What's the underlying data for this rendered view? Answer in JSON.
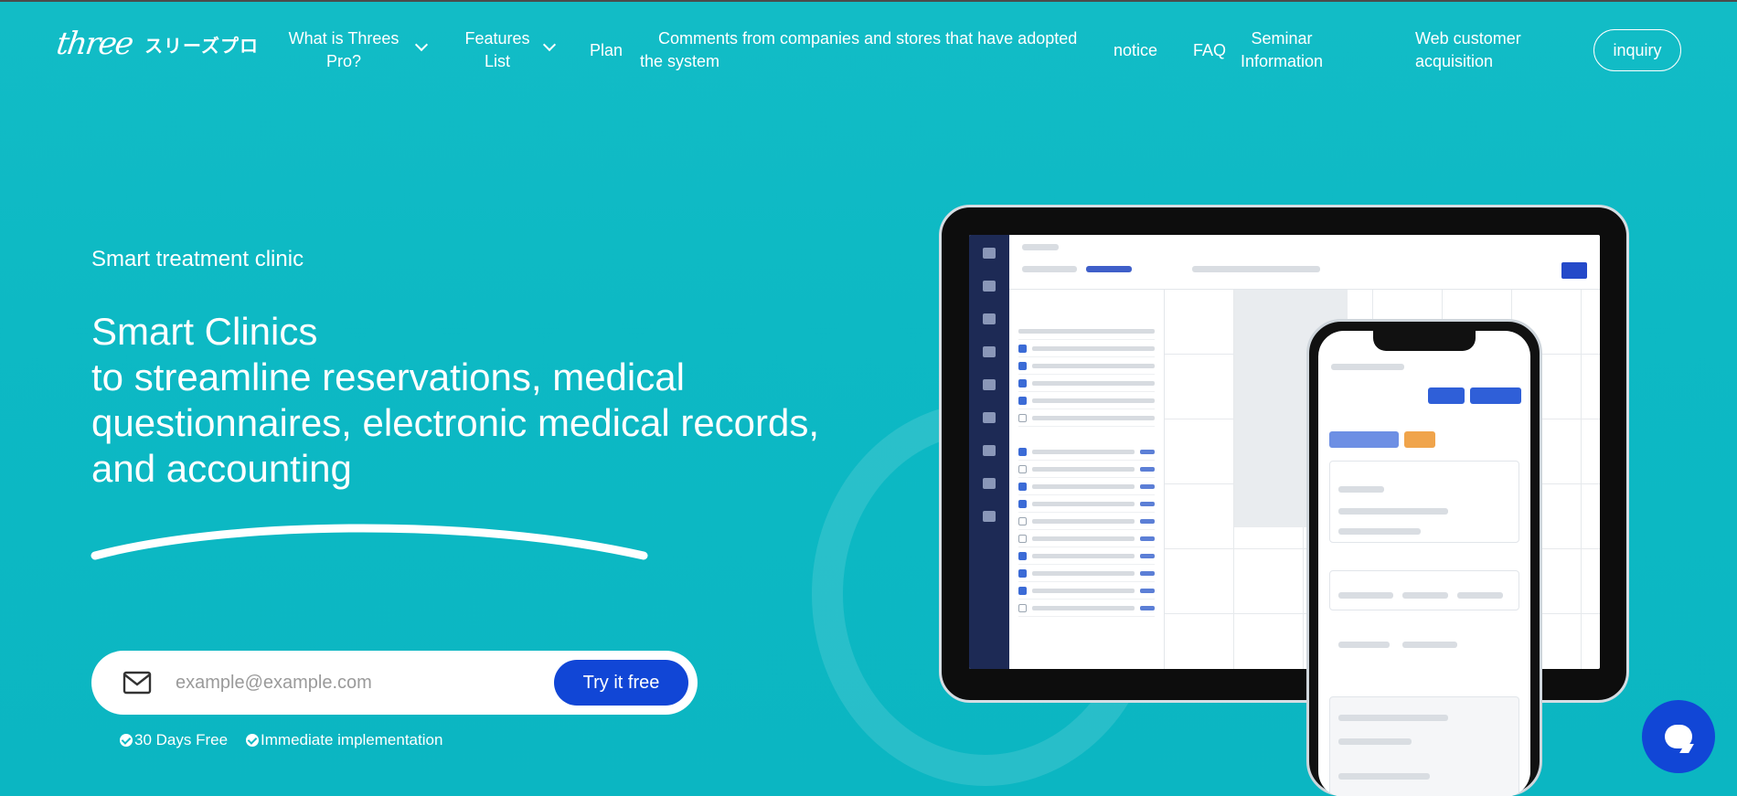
{
  "nav": {
    "logo_script": "three",
    "logo_jp": "スリーズプロ",
    "items": [
      {
        "label": "What is Threes Pro?",
        "dropdown": true
      },
      {
        "label": "Features List",
        "dropdown": true
      },
      {
        "label": "Plan",
        "dropdown": false
      },
      {
        "label": "Comments from companies and stores that have adopted the system",
        "dropdown": false
      },
      {
        "label": "notice",
        "dropdown": false
      },
      {
        "label": "FAQ",
        "dropdown": false
      },
      {
        "label": "Seminar Information",
        "dropdown": false
      },
      {
        "label": "Web customer acquisition",
        "dropdown": false
      }
    ],
    "inquiry_label": "inquiry"
  },
  "hero": {
    "eyebrow": "Smart treatment clinic",
    "headline_lines": [
      "Smart Clinics",
      "to streamline reservations, medical",
      "questionnaires, electronic medical records,",
      "and accounting"
    ]
  },
  "signup": {
    "email_placeholder": "example@example.com",
    "email_value": "",
    "cta_label": "Try it free",
    "benefits": [
      "30 Days Free",
      "Immediate implementation"
    ]
  },
  "colors": {
    "background": "#0db9c4",
    "cta": "#1146d6",
    "chat": "#1146d6"
  },
  "icons": {
    "mail": "mail-icon",
    "check": "check-circle-icon",
    "chevron": "chevron-down-icon",
    "chat": "chat-bubble-icon"
  }
}
